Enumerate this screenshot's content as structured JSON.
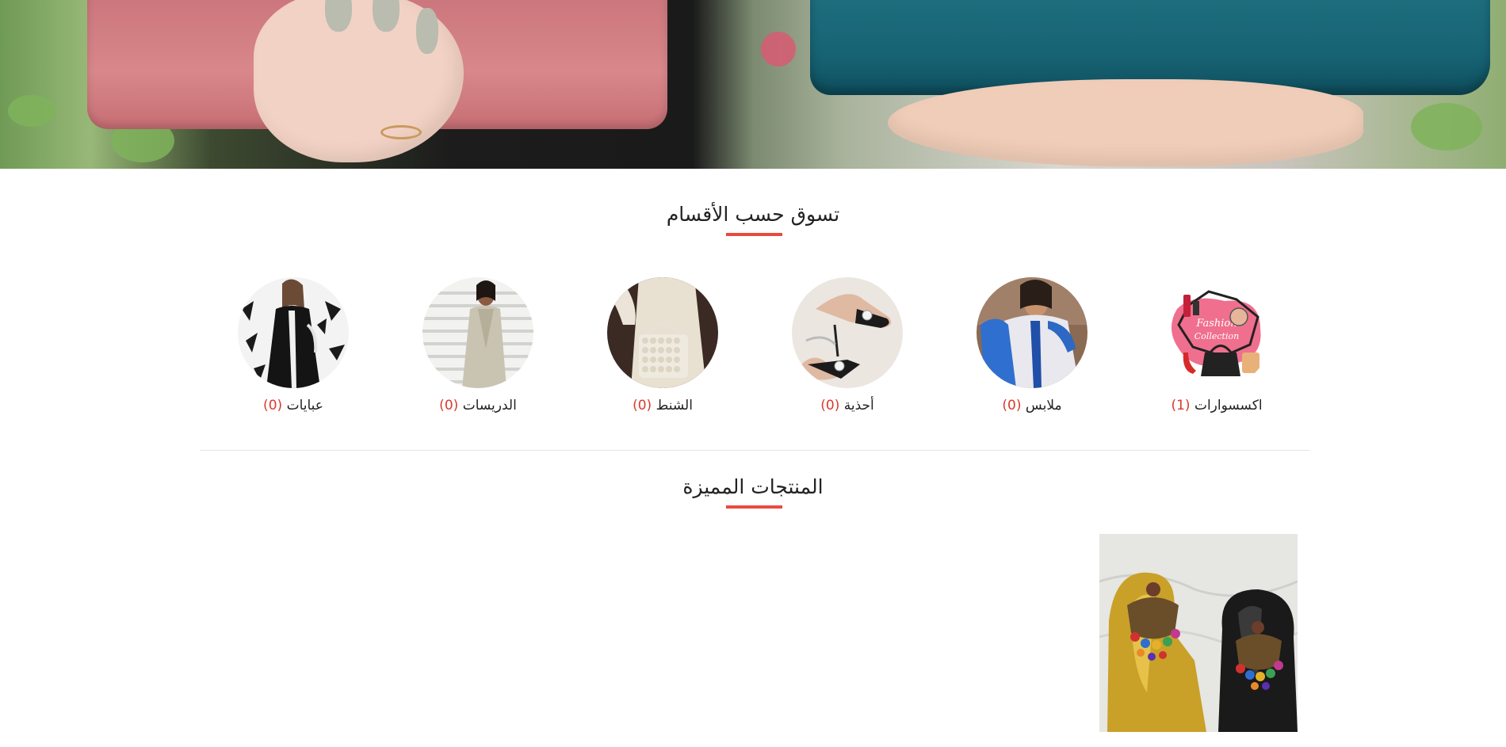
{
  "hero": {
    "image": "clutch-bags-banner"
  },
  "categories_section": {
    "title": "تسوق حسب الأقسام",
    "accent_color": "#e84b3c",
    "items": [
      {
        "name": "اكسسوارات",
        "count": "(1)",
        "icon": "fashion-collection-image"
      },
      {
        "name": "ملابس",
        "count": "(0)",
        "icon": "blue-kaftan-image"
      },
      {
        "name": "أحذية",
        "count": "(0)",
        "icon": "heels-image"
      },
      {
        "name": "الشنط",
        "count": "(0)",
        "icon": "pearl-bag-image"
      },
      {
        "name": "الدريسات",
        "count": "(0)",
        "icon": "dress-image"
      },
      {
        "name": "عبايات",
        "count": "(0)",
        "icon": "abaya-image"
      }
    ]
  },
  "featured_section": {
    "title": "المنتجات المميزة",
    "products": [
      {
        "image": "colorful-earrings-product-image"
      }
    ]
  }
}
